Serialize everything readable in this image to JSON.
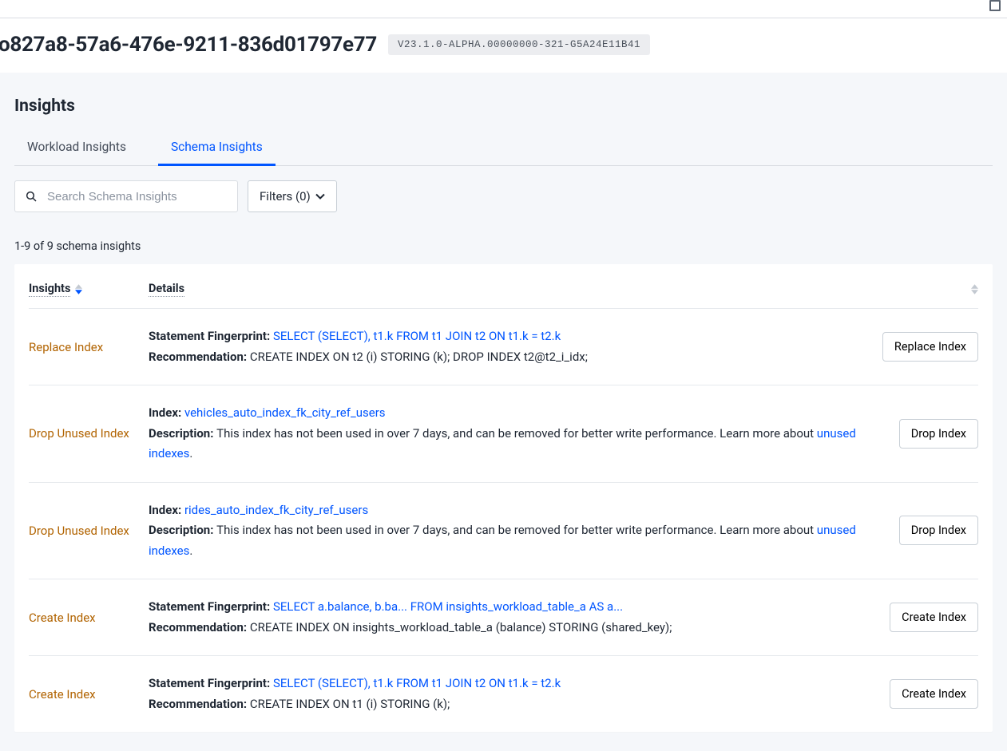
{
  "header": {
    "uuid": "o827a8-57a6-476e-9211-836d01797e77",
    "version": "V23.1.0-ALPHA.00000000-321-G5A24E11B41"
  },
  "page": {
    "title": "Insights",
    "tabs": [
      {
        "label": "Workload Insights",
        "active": false
      },
      {
        "label": "Schema Insights",
        "active": true
      }
    ],
    "search_placeholder": "Search Schema Insights",
    "filters_label": "Filters (0)",
    "result_count": "1-9 of 9 schema insights",
    "columns": {
      "insights": "Insights",
      "details": "Details"
    }
  },
  "rows": [
    {
      "insight": "Replace Index",
      "line1_label": "Statement Fingerprint:",
      "line1_link": "SELECT (SELECT), t1.k FROM t1 JOIN t2 ON t1.k = t2.k",
      "line2_label": "Recommendation:",
      "line2_text": "CREATE INDEX ON t2 (i) STORING (k); DROP INDEX t2@t2_i_idx;",
      "action": "Replace Index"
    },
    {
      "insight": "Drop Unused Index",
      "line1_label": "Index:",
      "line1_link": "vehicles_auto_index_fk_city_ref_users",
      "line2_label": "Description:",
      "line2_text": "This index has not been used in over 7 days, and can be removed for better write performance. Learn more about ",
      "line2_link": "unused indexes",
      "line2_after": ".",
      "action": "Drop Index"
    },
    {
      "insight": "Drop Unused Index",
      "line1_label": "Index:",
      "line1_link": "rides_auto_index_fk_city_ref_users",
      "line2_label": "Description:",
      "line2_text": "This index has not been used in over 7 days, and can be removed for better write performance. Learn more about ",
      "line2_link": "unused indexes",
      "line2_after": ".",
      "action": "Drop Index"
    },
    {
      "insight": "Create Index",
      "line1_label": "Statement Fingerprint:",
      "line1_link": "SELECT a.balance, b.ba... FROM insights_workload_table_a AS a...",
      "line2_label": "Recommendation:",
      "line2_text": "CREATE INDEX ON insights_workload_table_a (balance) STORING (shared_key);",
      "action": "Create Index"
    },
    {
      "insight": "Create Index",
      "line1_label": "Statement Fingerprint:",
      "line1_link": "SELECT (SELECT), t1.k FROM t1 JOIN t2 ON t1.k = t2.k",
      "line2_label": "Recommendation:",
      "line2_text": "CREATE INDEX ON t1 (i) STORING (k);",
      "action": "Create Index"
    }
  ]
}
